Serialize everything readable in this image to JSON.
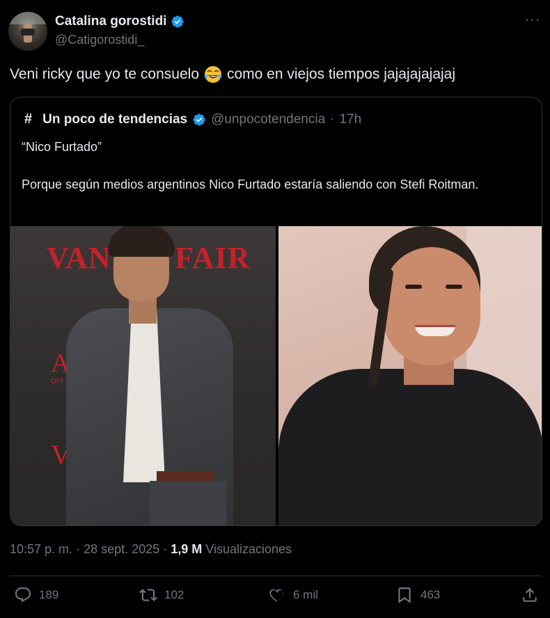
{
  "author": {
    "name": "Catalina gorostidi",
    "handle": "@Catigorostidi_"
  },
  "menu_glyph": "···",
  "tweet": {
    "text_before": "Veni ricky que yo te consuelo",
    "emoji": "tears-of-joy-emoji",
    "text_after": "como en viejos tiempos jajajajajajaj"
  },
  "quote": {
    "icon": "#",
    "name": "Un poco de tendencias",
    "handle": "@unpocotendencia",
    "separator": "·",
    "time": "17h",
    "line1": "“Nico Furtado”",
    "line2": "Porque según medios argentinos Nico Furtado estaría saliendo con Stefi Roitman.",
    "image_left": {
      "sign_big": "VANITY FAIR",
      "sign_a": "A",
      "sign_off": "OFF",
      "sign_v": "V"
    }
  },
  "meta": {
    "time": "10:57 p. m.",
    "dot1": "·",
    "date": "28 sept. 2025",
    "dot2": "·",
    "views_count": "1,9 M",
    "views_label": "Visualizaciones"
  },
  "actions": {
    "replies": "189",
    "retweets": "102",
    "likes": "6 mil",
    "bookmarks": "463"
  },
  "colors": {
    "background": "#000000",
    "text": "#e7e9ea",
    "secondary": "#71767b",
    "verified": "#1d9bf0",
    "border": "#2f3336"
  }
}
